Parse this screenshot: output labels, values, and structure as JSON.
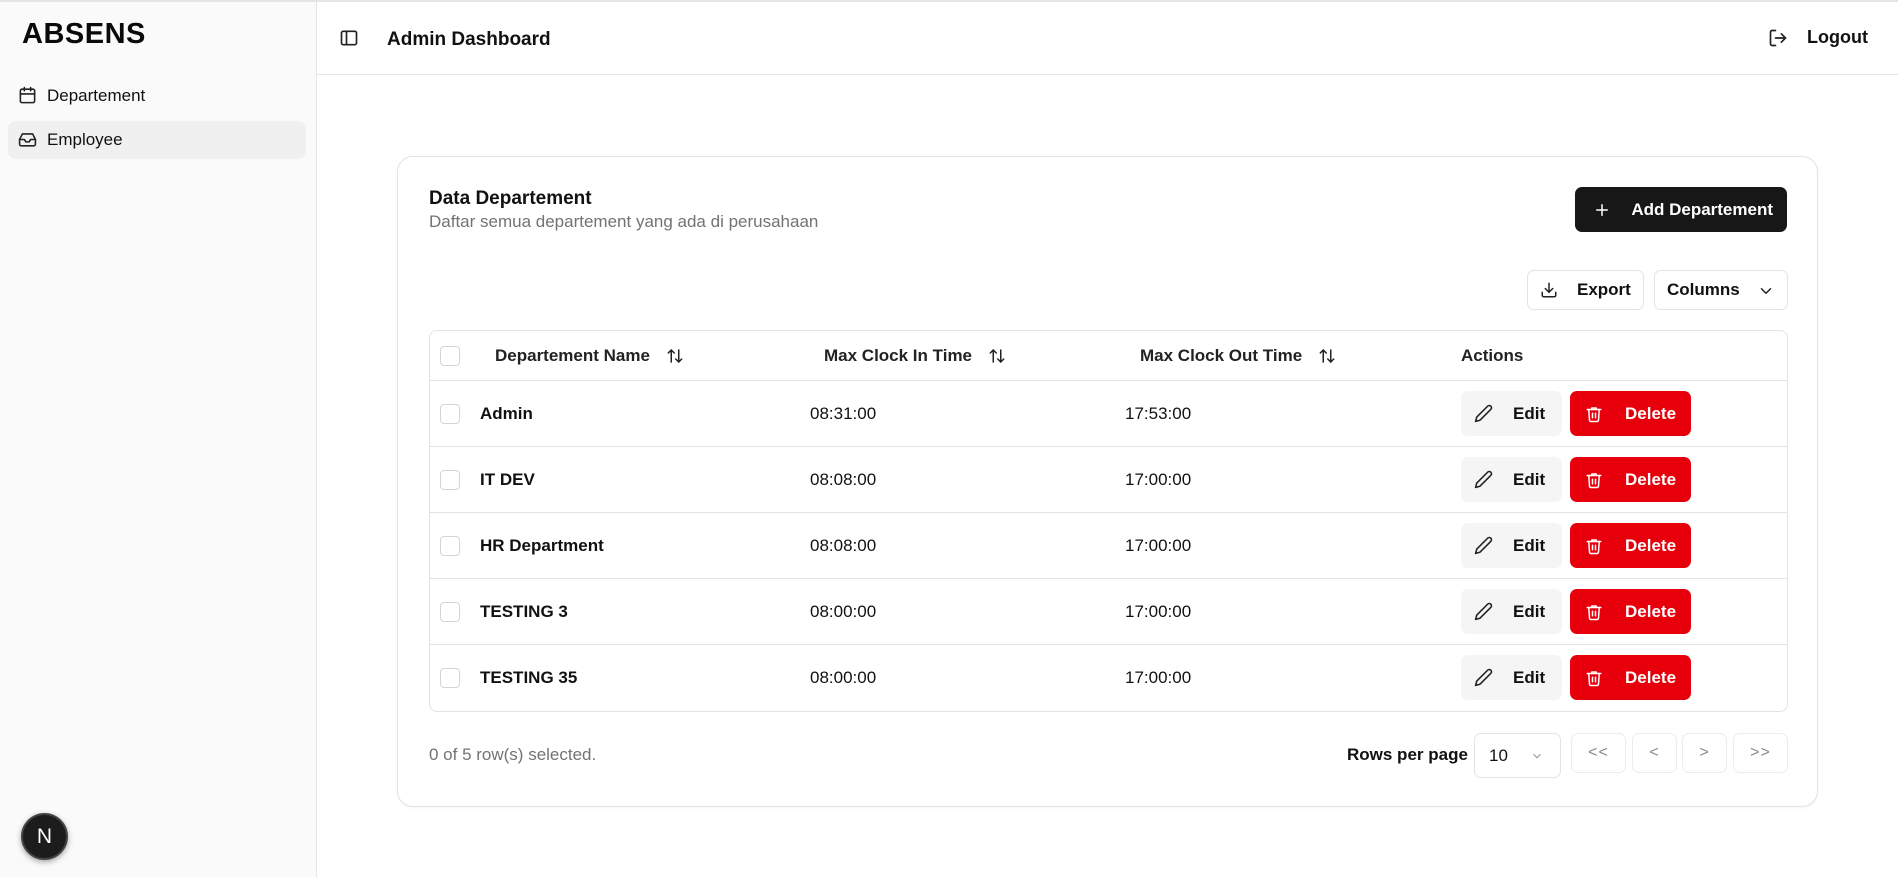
{
  "app": {
    "brand": "ABSENS",
    "avatar_letter": "N"
  },
  "sidebar": {
    "items": [
      {
        "label": "Departement",
        "icon": "calendar-icon"
      },
      {
        "label": "Employee",
        "icon": "inbox-icon"
      }
    ]
  },
  "header": {
    "title": "Admin Dashboard",
    "logout_label": "Logout"
  },
  "card": {
    "title": "Data Departement",
    "subtitle": "Daftar semua departement yang ada di perusahaan",
    "add_button": "Add Departement",
    "export_button": "Export",
    "columns_button": "Columns"
  },
  "table": {
    "headers": {
      "name": "Departement Name",
      "clock_in": "Max Clock In Time",
      "clock_out": "Max Clock Out Time",
      "actions": "Actions"
    },
    "edit_label": "Edit",
    "delete_label": "Delete",
    "rows": [
      {
        "name": "Admin",
        "clock_in": "08:31:00",
        "clock_out": "17:53:00"
      },
      {
        "name": "IT DEV",
        "clock_in": "08:08:00",
        "clock_out": "17:00:00"
      },
      {
        "name": "HR Department",
        "clock_in": "08:08:00",
        "clock_out": "17:00:00"
      },
      {
        "name": "TESTING 3",
        "clock_in": "08:00:00",
        "clock_out": "17:00:00"
      },
      {
        "name": "TESTING 35",
        "clock_in": "08:00:00",
        "clock_out": "17:00:00"
      }
    ]
  },
  "footer": {
    "selected_text": "0 of 5 row(s) selected.",
    "rows_per_page_label": "Rows per page",
    "rows_per_page_value": "10",
    "pagination": {
      "first": "<<",
      "prev": "<",
      "next": ">",
      "last": ">>"
    }
  },
  "colors": {
    "primary": "#171717",
    "danger": "#e7000b",
    "muted": "#737373"
  }
}
